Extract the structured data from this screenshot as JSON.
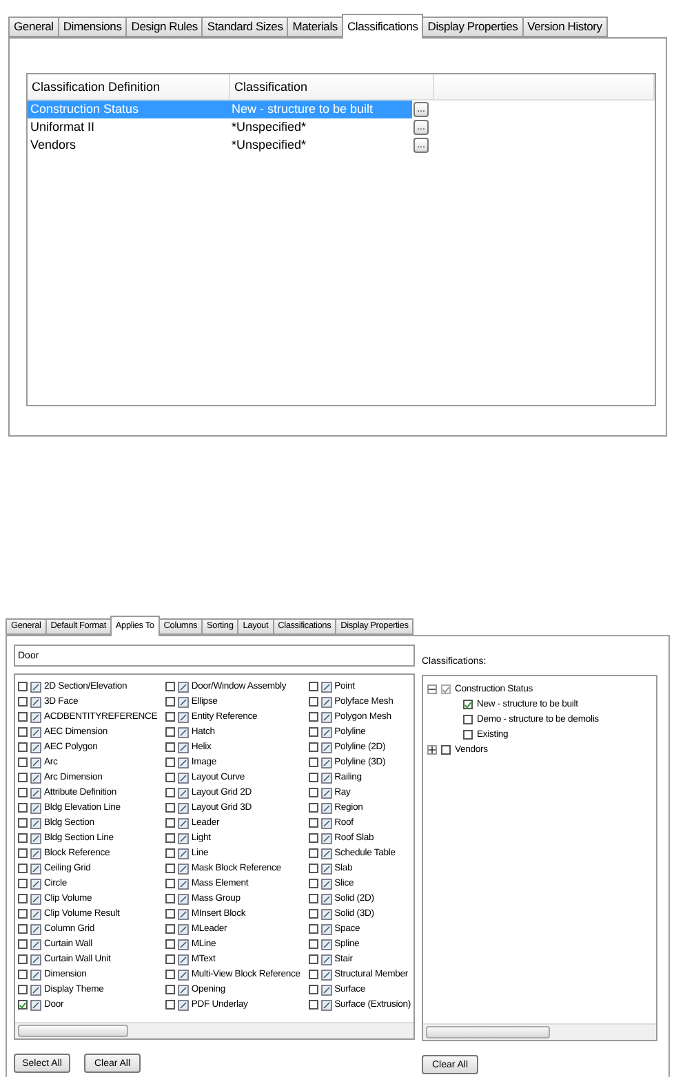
{
  "style_dialog": {
    "tabs": [
      {
        "label": "General",
        "selected": false
      },
      {
        "label": "Dimensions",
        "selected": false
      },
      {
        "label": "Design Rules",
        "selected": false
      },
      {
        "label": "Standard Sizes",
        "selected": false
      },
      {
        "label": "Materials",
        "selected": false
      },
      {
        "label": "Classifications",
        "selected": true
      },
      {
        "label": "Display Properties",
        "selected": false
      },
      {
        "label": "Version History",
        "selected": false
      }
    ],
    "table": {
      "columns": [
        "Classification Definition",
        "Classification"
      ],
      "rows": [
        {
          "definition": "Construction Status",
          "classification": "New - structure to be built",
          "button": "...",
          "selected": true
        },
        {
          "definition": "Uniformat II",
          "classification": "*Unspecified*",
          "button": "...",
          "selected": false
        },
        {
          "definition": "Vendors",
          "classification": "*Unspecified*",
          "button": "...",
          "selected": false
        }
      ]
    }
  },
  "schedule_dialog": {
    "tabs": [
      {
        "label": "General",
        "selected": false
      },
      {
        "label": "Default Format",
        "selected": false
      },
      {
        "label": "Applies To",
        "selected": true
      },
      {
        "label": "Columns",
        "selected": false
      },
      {
        "label": "Sorting",
        "selected": false
      },
      {
        "label": "Layout",
        "selected": false
      },
      {
        "label": "Classifications",
        "selected": false
      },
      {
        "label": "Display Properties",
        "selected": false
      }
    ],
    "filter": {
      "value": "Door"
    },
    "objects": [
      {
        "label": "2D Section/Elevation",
        "checked": false
      },
      {
        "label": "3D Face",
        "checked": false
      },
      {
        "label": "ACDBENTITYREFERENCE",
        "checked": false
      },
      {
        "label": "AEC Dimension",
        "checked": false
      },
      {
        "label": "AEC Polygon",
        "checked": false
      },
      {
        "label": "Arc",
        "checked": false
      },
      {
        "label": "Arc Dimension",
        "checked": false
      },
      {
        "label": "Attribute Definition",
        "checked": false
      },
      {
        "label": "Bldg Elevation Line",
        "checked": false
      },
      {
        "label": "Bldg Section",
        "checked": false
      },
      {
        "label": "Bldg Section Line",
        "checked": false
      },
      {
        "label": "Block Reference",
        "checked": false
      },
      {
        "label": "Ceiling Grid",
        "checked": false
      },
      {
        "label": "Circle",
        "checked": false
      },
      {
        "label": "Clip Volume",
        "checked": false
      },
      {
        "label": "Clip Volume Result",
        "checked": false
      },
      {
        "label": "Column Grid",
        "checked": false
      },
      {
        "label": "Curtain Wall",
        "checked": false
      },
      {
        "label": "Curtain Wall Unit",
        "checked": false
      },
      {
        "label": "Dimension",
        "checked": false
      },
      {
        "label": "Display Theme",
        "checked": false
      },
      {
        "label": "Door",
        "checked": true
      },
      {
        "label": "Door/Window Assembly",
        "checked": false
      },
      {
        "label": "Ellipse",
        "checked": false
      },
      {
        "label": "Entity Reference",
        "checked": false
      },
      {
        "label": "Hatch",
        "checked": false
      },
      {
        "label": "Helix",
        "checked": false
      },
      {
        "label": "Image",
        "checked": false
      },
      {
        "label": "Layout Curve",
        "checked": false
      },
      {
        "label": "Layout Grid 2D",
        "checked": false
      },
      {
        "label": "Layout Grid 3D",
        "checked": false
      },
      {
        "label": "Leader",
        "checked": false
      },
      {
        "label": "Light",
        "checked": false
      },
      {
        "label": "Line",
        "checked": false
      },
      {
        "label": "Mask Block Reference",
        "checked": false
      },
      {
        "label": "Mass Element",
        "checked": false
      },
      {
        "label": "Mass Group",
        "checked": false
      },
      {
        "label": "MInsert Block",
        "checked": false
      },
      {
        "label": "MLeader",
        "checked": false
      },
      {
        "label": "MLine",
        "checked": false
      },
      {
        "label": "MText",
        "checked": false
      },
      {
        "label": "Multi-View Block Reference",
        "checked": false
      },
      {
        "label": "Opening",
        "checked": false
      },
      {
        "label": "PDF Underlay",
        "checked": false
      },
      {
        "label": "Point",
        "checked": false
      },
      {
        "label": "Polyface Mesh",
        "checked": false
      },
      {
        "label": "Polygon Mesh",
        "checked": false
      },
      {
        "label": "Polyline",
        "checked": false
      },
      {
        "label": "Polyline (2D)",
        "checked": false
      },
      {
        "label": "Polyline (3D)",
        "checked": false
      },
      {
        "label": "Railing",
        "checked": false
      },
      {
        "label": "Ray",
        "checked": false
      },
      {
        "label": "Region",
        "checked": false
      },
      {
        "label": "Roof",
        "checked": false
      },
      {
        "label": "Roof Slab",
        "checked": false
      },
      {
        "label": "Schedule Table",
        "checked": false
      },
      {
        "label": "Slab",
        "checked": false
      },
      {
        "label": "Slice",
        "checked": false
      },
      {
        "label": "Solid (2D)",
        "checked": false
      },
      {
        "label": "Solid (3D)",
        "checked": false
      },
      {
        "label": "Space",
        "checked": false
      },
      {
        "label": "Spline",
        "checked": false
      },
      {
        "label": "Stair",
        "checked": false
      },
      {
        "label": "Structural Member",
        "checked": false
      },
      {
        "label": "Surface",
        "checked": false
      },
      {
        "label": "Surface (Extrusion)",
        "checked": false
      }
    ],
    "select_all": "Select All",
    "clear_all": "Clear All",
    "classifications_label": "Classifications:",
    "tree": [
      {
        "label": "Construction Status",
        "checked": true,
        "dimmed": true,
        "expanded": true,
        "children": [
          {
            "label": "New - structure to be built",
            "checked": true
          },
          {
            "label": "Demo - structure to be demolis",
            "checked": false
          },
          {
            "label": "Existing",
            "checked": false
          }
        ]
      },
      {
        "label": "Vendors",
        "checked": false,
        "expanded": false
      }
    ],
    "tree_clear_all": "Clear All"
  }
}
